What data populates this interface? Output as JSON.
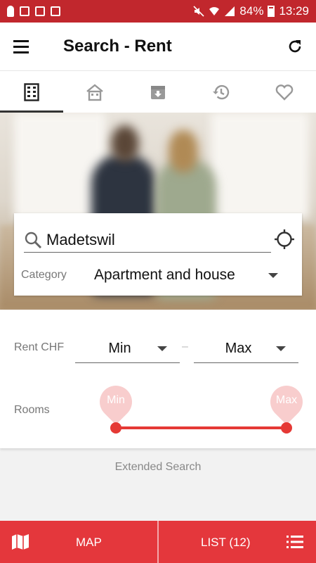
{
  "status_bar": {
    "battery": "84%",
    "time": "13:29"
  },
  "app_bar": {
    "title": "Search - Rent"
  },
  "tabs": [
    {
      "icon": "building-icon",
      "active": true
    },
    {
      "icon": "house-icon",
      "active": false
    },
    {
      "icon": "archive-icon",
      "active": false
    },
    {
      "icon": "history-icon",
      "active": false
    },
    {
      "icon": "heart-icon",
      "active": false
    }
  ],
  "search": {
    "location_value": "Madetswil",
    "category_label": "Category",
    "category_value": "Apartment and house"
  },
  "filters": {
    "rent_label": "Rent CHF",
    "rent_min": "Min",
    "rent_max": "Max",
    "separator": "–",
    "rooms_label": "Rooms",
    "rooms_min": "Min",
    "rooms_max": "Max"
  },
  "extended_search": "Extended Search",
  "bottom_bar": {
    "map_label": "MAP",
    "list_label": "LIST (12)"
  },
  "colors": {
    "status_bar": "#c1272d",
    "accent": "#e4373c",
    "slider": "#e53935",
    "slider_pin": "#f8cdcd"
  }
}
